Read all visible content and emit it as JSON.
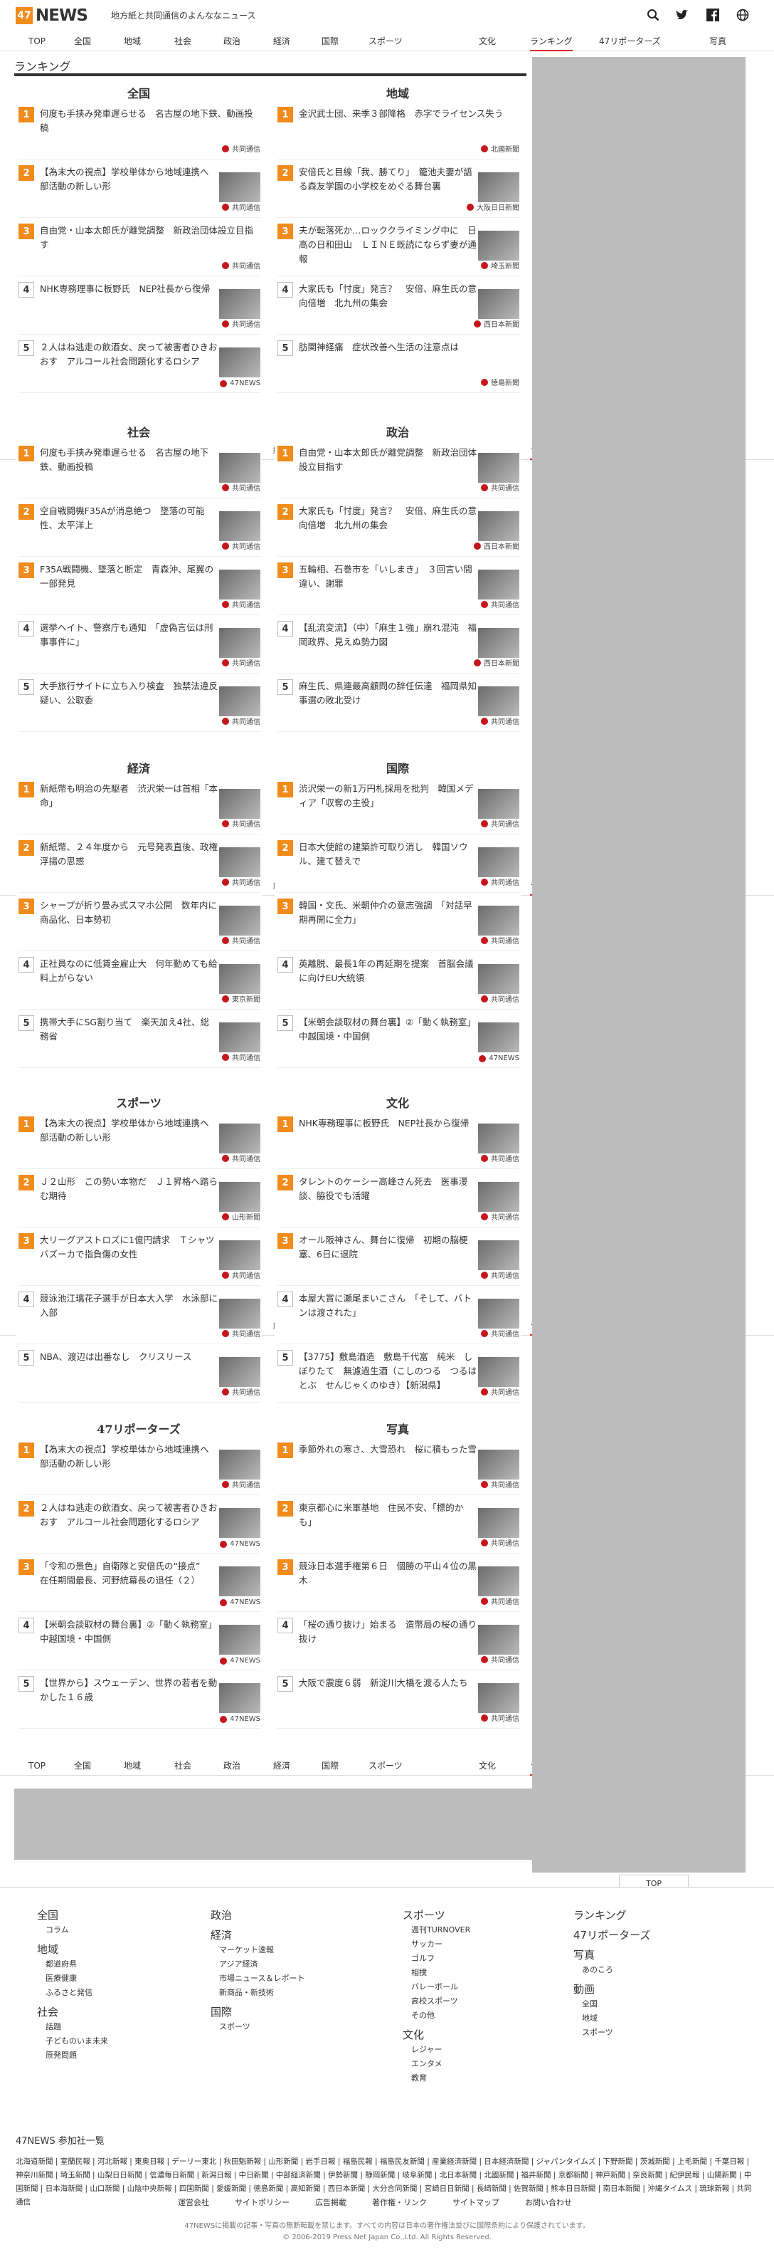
{
  "header": {
    "logo_num": "47",
    "logo_text": "NEWS",
    "tagline": "地方紙と共同通信のよんななニュース"
  },
  "nav": [
    "TOP",
    "全国",
    "地域",
    "社会",
    "政治",
    "経済",
    "国際",
    "スポーツ",
    "文化",
    "ランキング",
    "47リポーターズ",
    "写真"
  ],
  "section_title": "ランキング",
  "cats": [
    {
      "name": "全国",
      "items": [
        {
          "r": "1",
          "t": "何度も手挟み発車遅らせる　名古屋の地下鉄、動画投稿",
          "s": "共同通信"
        },
        {
          "r": "2",
          "t": "【為末大の視点】学校単体から地域連携へ　部活動の新しい形",
          "s": "共同通信"
        },
        {
          "r": "3",
          "t": "自由党・山本太郎氏が離党調整　新政治団体設立目指す",
          "s": "共同通信"
        },
        {
          "r": "4",
          "t": "NHK専務理事に板野氏　NEP社長から復帰",
          "s": "共同通信"
        },
        {
          "r": "5",
          "t": "２人はね逃走の飲酒女、戻って被害者ひきおおす　アルコール社会問題化するロシア",
          "s": "47NEWS"
        }
      ]
    },
    {
      "name": "地域",
      "items": [
        {
          "r": "1",
          "t": "金沢武士団、来季３部降格　赤字でライセンス失う",
          "s": "北國新聞"
        },
        {
          "r": "2",
          "t": "安倍氏と目線「我、勝てり」　籠池夫妻が語る森友学園の小学校をめぐる舞台裏",
          "s": "大阪日日新聞"
        },
        {
          "r": "3",
          "t": "夫が転落死か…ロッククライミング中に　日高の日和田山　ＬＩＮＥ既読にならず妻が通報",
          "s": "埼玉新聞"
        },
        {
          "r": "4",
          "t": "大家氏も「忖度」発言？　安倍、麻生氏の意向倍増　北九州の集会",
          "s": "西日本新聞"
        },
        {
          "r": "5",
          "t": "肪関神経痛　症状改善へ生活の注意点は",
          "s": "徳島新聞"
        }
      ]
    },
    {
      "name": "社会",
      "items": [
        {
          "r": "1",
          "t": "何度も手挟み発車遅らせる　名古屋の地下鉄、動画投稿",
          "s": "共同通信"
        },
        {
          "r": "2",
          "t": "空自戦闘機F35Aが消息絶つ　墜落の可能性、太平洋上",
          "s": "共同通信"
        },
        {
          "r": "3",
          "t": "F35A戦闘機、墜落と断定　青森沖、尾翼の一部発見",
          "s": "共同通信"
        },
        {
          "r": "4",
          "t": "選挙ヘイト、警察庁も通知　「虚偽言伝は刑事事件に」",
          "s": "共同通信"
        },
        {
          "r": "5",
          "t": "大手旅行サイトに立ち入り検査　独禁法違反疑い、公取委",
          "s": "共同通信"
        }
      ]
    },
    {
      "name": "政治",
      "items": [
        {
          "r": "1",
          "t": "自由党・山本太郎氏が離党調整　新政治団体設立目指す",
          "s": "共同通信"
        },
        {
          "r": "2",
          "t": "大家氏も「忖度」発言？　安倍、麻生氏の意向倍増　北九州の集会",
          "s": "西日本新聞"
        },
        {
          "r": "3",
          "t": "五輪相、石巻市を「いしまき」　３回言い間違い、謝罪",
          "s": "共同通信"
        },
        {
          "r": "4",
          "t": "【乱流変流】（中）「麻生１強」崩れ混沌　福岡政界、見えぬ勢力図",
          "s": "西日本新聞"
        },
        {
          "r": "5",
          "t": "麻生氏、県連最高顧問の辞任伝達　福岡県知事選の敗北受け",
          "s": "共同通信"
        }
      ]
    },
    {
      "name": "経済",
      "items": [
        {
          "r": "1",
          "t": "新紙幣も明治の先駆者　渋沢栄一は首相「本命」",
          "s": "共同通信"
        },
        {
          "r": "2",
          "t": "新紙幣、２４年度から　元号発表直後、政権浮揚の思惑",
          "s": "共同通信"
        },
        {
          "r": "3",
          "t": "シャープが折り畳み式スマホ公開　数年内に商品化、日本勢初",
          "s": "共同通信"
        },
        {
          "r": "4",
          "t": "正社員なのに低賃金雇止大　何年勤めても給料上がらない",
          "s": "東京新聞"
        },
        {
          "r": "5",
          "t": "携帯大手にSG割り当て　楽天加え4社、総務省",
          "s": "共同通信"
        }
      ]
    },
    {
      "name": "国際",
      "items": [
        {
          "r": "1",
          "t": "渋沢栄一の新1万円札採用を批判　韓国メディア「収奪の主役」",
          "s": "共同通信"
        },
        {
          "r": "2",
          "t": "日本大使館の建築許可取り消し　韓国ソウル、建て替えで",
          "s": "共同通信"
        },
        {
          "r": "3",
          "t": "韓国・文氏、米朝仲介の意志強調　「対話早期再開に全力」",
          "s": "共同通信"
        },
        {
          "r": "4",
          "t": "英離脱、最長1年の再延期を提案　首脳会議に向けEU大統領",
          "s": "共同通信"
        },
        {
          "r": "5",
          "t": "【米朝会談取材の舞台裏】②「動く執務室」　中越国境・中国側",
          "s": "47NEWS"
        }
      ]
    },
    {
      "name": "スポーツ",
      "items": [
        {
          "r": "1",
          "t": "【為末大の視点】学校単体から地域連携へ　部活動の新しい形",
          "s": "共同通信"
        },
        {
          "r": "2",
          "t": "Ｊ２山形　この勢い本物だ　Ｊ１昇格へ踏らむ期待",
          "s": "山形新聞"
        },
        {
          "r": "3",
          "t": "大リーグアストロズに1億円請求　Ｔシャツバズーカで指負傷の女性",
          "s": "共同通信"
        },
        {
          "r": "4",
          "t": "競泳池江璃花子選手が日本大入学　水泳部に入部",
          "s": "共同通信"
        },
        {
          "r": "5",
          "t": "NBA、渡辺は出番なし　クリスリース",
          "s": "共同通信"
        }
      ]
    },
    {
      "name": "文化",
      "items": [
        {
          "r": "1",
          "t": "NHK専務理事に板野氏　NEP社長から復帰",
          "s": "共同通信"
        },
        {
          "r": "2",
          "t": "タレントのケーシー高峰さん死去　医事漫談、脇役でも活躍",
          "s": "共同通信"
        },
        {
          "r": "3",
          "t": "オール阪神さん、舞台に復帰　初期の脳梗塞、6日に退院",
          "s": "共同通信"
        },
        {
          "r": "4",
          "t": "本屋大賞に瀬尾まいこさん　「そして、バトンは渡された」",
          "s": "共同通信"
        },
        {
          "r": "5",
          "t": "【3775】敷島酒造　敷島千代富　純米　しぼりたて　無濾過生酒（こしのつる　つるはとぶ　せんじゃくのゆき）【新潟県】",
          "s": "共同通信"
        }
      ]
    },
    {
      "name": "47リポーターズ",
      "items": [
        {
          "r": "1",
          "t": "【為末大の視点】学校単体から地域連携へ　部活動の新しい形",
          "s": "共同通信"
        },
        {
          "r": "2",
          "t": "２人はね逃走の飲酒女、戻って被害者ひきおおす　アルコール社会問題化するロシア",
          "s": "47NEWS"
        },
        {
          "r": "3",
          "t": "「令和の景色」自衛隊と安倍氏の“接点”　在任期間最長、河野統幕長の退任（２）",
          "s": "47NEWS"
        },
        {
          "r": "4",
          "t": "【米朝会談取材の舞台裏】②「動く執務室」　中越国境・中国側",
          "s": "47NEWS"
        },
        {
          "r": "5",
          "t": "【世界から】スウェーデン、世界の若者を動かした１６歳",
          "s": "47NEWS"
        }
      ]
    },
    {
      "name": "写真",
      "items": [
        {
          "r": "1",
          "t": "季節外れの寒さ、大雪恐れ　桜に積もった雪",
          "s": "共同通信"
        },
        {
          "r": "2",
          "t": "東京都心に米軍基地　住民不安、「標的かも」",
          "s": "共同通信"
        },
        {
          "r": "3",
          "t": "競泳日本選手権第６日　個勝の平山４位の黒木",
          "s": "共同通信"
        },
        {
          "r": "4",
          "t": "「桜の通り抜け」始まる　造幣局の桜の通り抜け",
          "s": "共同通信"
        },
        {
          "r": "5",
          "t": "大阪で震度６弱　新淀川大橋を渡る人たち",
          "s": "共同通信"
        }
      ]
    }
  ],
  "top_btn": "TOP",
  "footer": {
    "cols": [
      {
        "items": [
          [
            "全国",
            [
              "コラム"
            ]
          ],
          [
            "地域",
            [
              "都道府県",
              "医療健康",
              "ふるさと発信"
            ]
          ],
          [
            "社会",
            [
              "話題",
              "子どものいま未来",
              "原発問題"
            ]
          ]
        ]
      },
      {
        "items": [
          [
            "政治",
            []
          ],
          [
            "経済",
            [
              "マーケット速報",
              "アジア経済",
              "市場ニュース＆レポート",
              "新商品・新技術"
            ]
          ],
          [
            "国際",
            [
              "スポーツ"
            ]
          ]
        ]
      },
      {
        "items": [
          [
            "スポーツ",
            [
              "週刊TURNOVER",
              "サッカー",
              "ゴルフ",
              "相撲",
              "バレーボール",
              "高校スポーツ",
              "その他"
            ]
          ],
          [
            "文化",
            [
              "レジャー",
              "エンタメ",
              "教育"
            ]
          ]
        ]
      },
      {
        "items": [
          [
            "ランキング",
            []
          ],
          [
            "47リポーターズ",
            []
          ],
          [
            "写真",
            [
              "あのころ"
            ]
          ],
          [
            "動画",
            [
              "全国",
              "地域",
              "スポーツ"
            ]
          ]
        ]
      }
    ],
    "members_title": "47NEWS 参加社一覧",
    "members": "北海道新聞 | 室蘭民報 | 河北新報 | 東奥日報 | デーリー東北 | 秋田魁新報 | 山形新聞 | 岩手日報 | 福島民報 | 福島民友新聞 | 産業経済新聞 | 日本経済新聞 | ジャパンタイムズ | 下野新聞 | 茨城新聞 | 上毛新聞 | 千葉日報 | 神奈川新聞 | 埼玉新聞 | 山梨日日新聞 | 信濃毎日新聞 | 新潟日報 | 中日新聞 | 中部経済新聞 | 伊勢新聞 | 静岡新聞 | 岐阜新聞 | 北日本新聞 | 北國新聞 | 福井新聞 | 京都新聞 | 神戸新聞 | 奈良新聞 | 紀伊民報 | 山陽新聞 | 中国新聞 | 日本海新聞 | 山口新聞 | 山陰中央新報 | 四国新聞 | 愛媛新聞 | 徳島新聞 | 高知新聞 | 西日本新聞 | 大分合同新聞 | 宮崎日日新聞 | 長崎新聞 | 佐賀新聞 | 熊本日日新聞 | 南日本新聞 | 沖縄タイムス | 琉球新報 | 共同通信",
    "links": [
      "運営会社",
      "サイトポリシー",
      "広告掲載",
      "著作権・リンク",
      "サイトマップ",
      "お問い合わせ"
    ],
    "notice": "47NEWSに掲載の記事・写真の無断転載を禁じます。すべての内容は日本の著作権法並びに国際条約により保護されています。",
    "copyright": "© 2006-2019 Press Net Japan Co.,Ltd. All Rights Reserved."
  }
}
